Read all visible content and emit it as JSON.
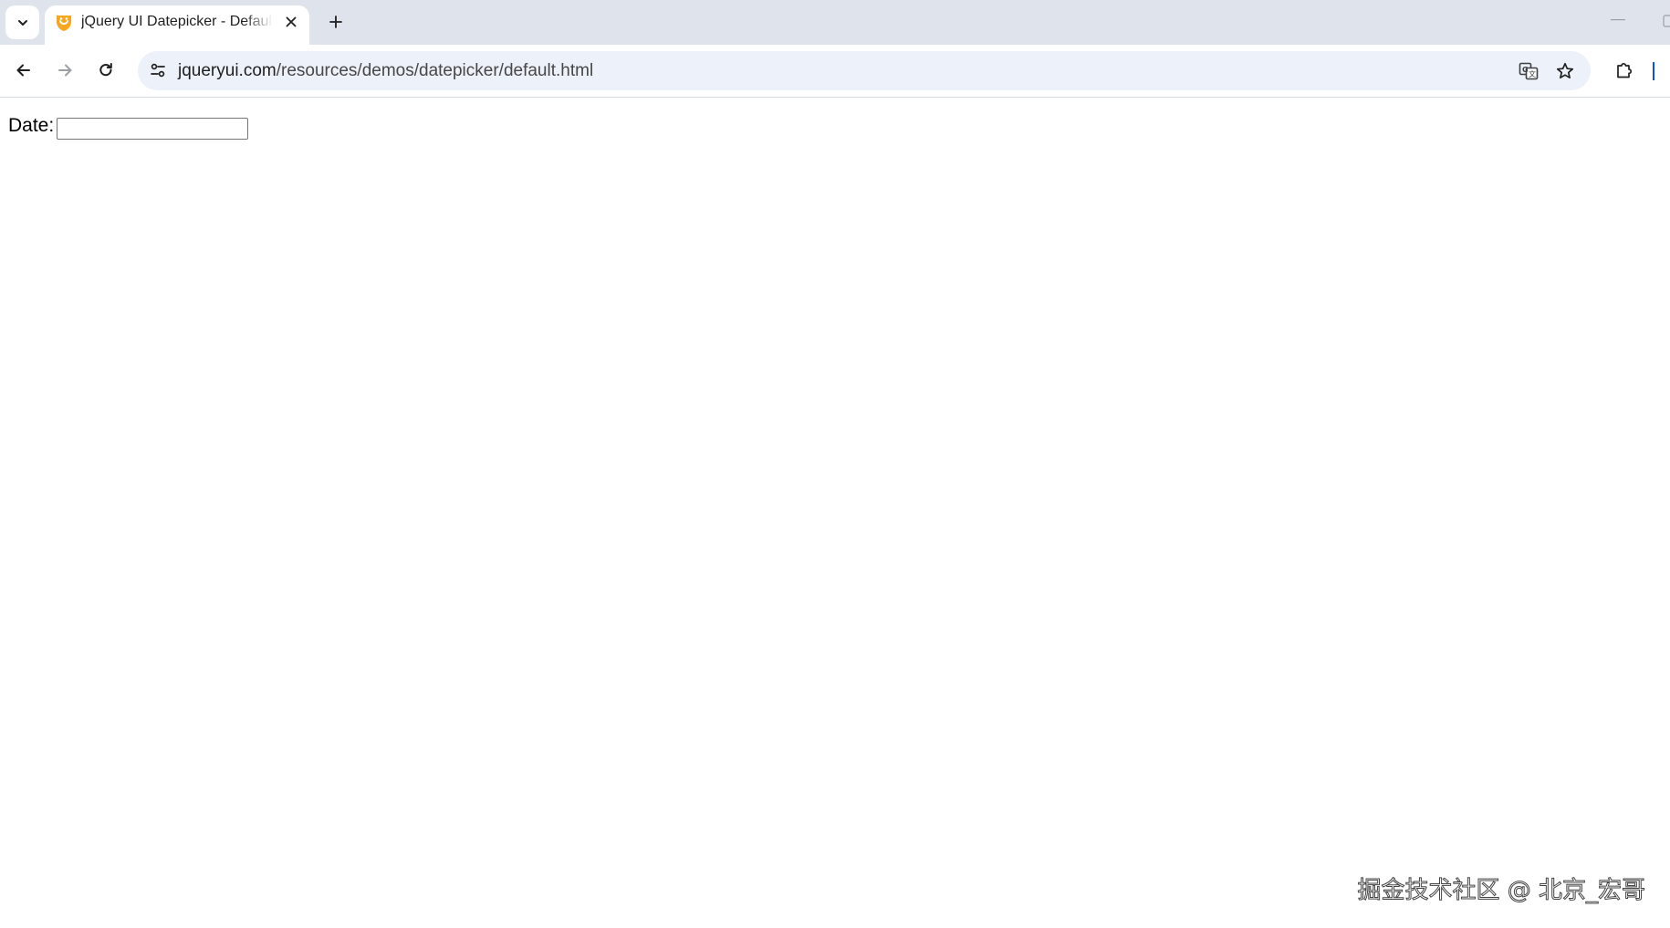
{
  "browser": {
    "tab": {
      "title": "jQuery UI Datepicker - Default functionality"
    },
    "address_bar": {
      "host": "jqueryui.com",
      "path": "/resources/demos/datepicker/default.html"
    },
    "icons": {
      "tab_search": "chevron-down-icon",
      "favicon": "jquery-ui-favicon",
      "close": "close-icon",
      "new_tab": "plus-icon",
      "back": "arrow-left-icon",
      "forward": "arrow-right-icon",
      "reload": "reload-icon",
      "site_info": "tune-icon",
      "translate": "translate-icon",
      "bookmark": "star-icon",
      "extensions": "puzzle-icon"
    },
    "colors": {
      "tab_strip": "#dfe3eb",
      "omnibox": "#edf1f9",
      "favicon": "#f6a71d",
      "accent": "#0b57d0"
    }
  },
  "page": {
    "date_label": "Date:",
    "date_input_value": ""
  },
  "watermark": "掘金技术社区 @ 北京_宏哥"
}
